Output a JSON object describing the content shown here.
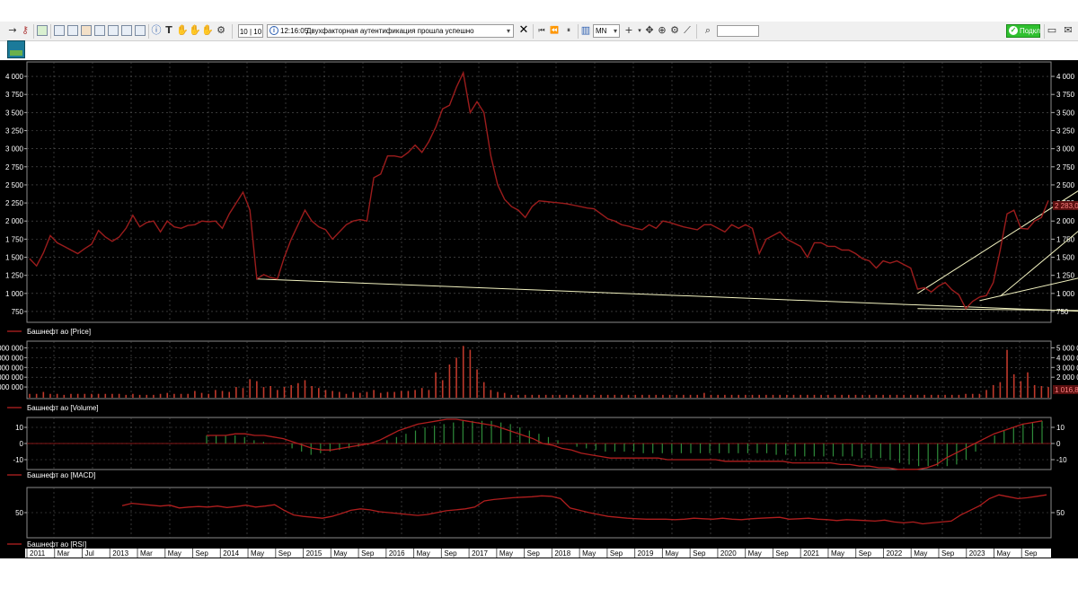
{
  "toolbar": {
    "counter": "10 | 10",
    "message_time": "12:16:05",
    "message_text": "Двухфакторная аутентификация прошла успешно",
    "timeframe": "MN",
    "connect_label": "Подкл"
  },
  "chart_data": [
    {
      "type": "line",
      "legend": "Башнефт ао [Price]",
      "yticks": [
        "4 000",
        "3 750",
        "3 500",
        "3 250",
        "3 000",
        "2 750",
        "2 500",
        "2 250",
        "2 000",
        "1 750",
        "1 500",
        "1 250",
        "1 000",
        "750"
      ],
      "yticks_right": [
        "4 000",
        "3 750",
        "3 500",
        "3 250",
        "3 000",
        "2 750",
        "2 500",
        "2 250",
        "2 000",
        "1 750",
        "1 500",
        "1 250",
        "1 000",
        "750"
      ],
      "ylim": [
        700,
        4100
      ],
      "last_price_label": "2 283,0",
      "series": [
        {
          "values": [
            1480,
            1380,
            1560,
            1800,
            1700,
            1650,
            1600,
            1550,
            1620,
            1680,
            1870,
            1780,
            1720,
            1780,
            1900,
            2080,
            1920,
            1980,
            2000,
            1850,
            2000,
            1920,
            1900,
            1940,
            1950,
            2000,
            1990,
            2000,
            1900,
            2100,
            2250,
            2400,
            2150,
            1200,
            1260,
            1220,
            1200,
            1500,
            1750,
            1950,
            2150,
            2000,
            1920,
            1880,
            1750,
            1850,
            1950,
            2000,
            2020,
            2000,
            2600,
            2650,
            2900,
            2900,
            2880,
            2950,
            3050,
            2950,
            3100,
            3300,
            3550,
            3600,
            3850,
            4050,
            3500,
            3650,
            3500,
            2900,
            2500,
            2300,
            2200,
            2150,
            2050,
            2200,
            2280,
            2270,
            2260,
            2250,
            2240,
            2220,
            2200,
            2180,
            2170,
            2100,
            2030,
            2000,
            1950,
            1930,
            1900,
            1880,
            1950,
            1900,
            2000,
            1980,
            1950,
            1920,
            1900,
            1880,
            1950,
            1950,
            1900,
            1850,
            1950,
            1900,
            1950,
            1900,
            1550,
            1750,
            1800,
            1850,
            1750,
            1700,
            1650,
            1500,
            1700,
            1700,
            1650,
            1650,
            1600,
            1600,
            1550,
            1480,
            1450,
            1350,
            1450,
            1420,
            1450,
            1400,
            1350,
            1060,
            1080,
            1020,
            1100,
            1150,
            1050,
            980,
            790,
            890,
            950,
            970,
            1150,
            1600,
            2100,
            2150,
            1900,
            1890,
            2000,
            2050,
            2283
          ]
        }
      ],
      "trendlines": [
        {
          "from": [
            33,
            1200
          ],
          "to": [
            156,
            740
          ]
        },
        {
          "from": [
            129,
            1000
          ],
          "to": [
            156,
            2640
          ]
        },
        {
          "from": [
            141,
            960
          ],
          "to": [
            156,
            2150
          ]
        },
        {
          "from": [
            138,
            900
          ],
          "to": [
            156,
            1290
          ]
        },
        {
          "from": [
            129,
            790
          ],
          "to": [
            156,
            760
          ]
        }
      ]
    },
    {
      "type": "bar",
      "legend": "Башнефт ао [Volume]",
      "yticks": [
        "000 000",
        "000 000",
        "000 000",
        "000 000",
        "000 000"
      ],
      "yticks_right": [
        "5 000 0",
        "4 000 0",
        "3 000 0",
        "2 000 0"
      ],
      "ylim": [
        0,
        5500000
      ],
      "last_value_label": "1 016,8",
      "series": [
        {
          "values": [
            300000,
            300000,
            500000,
            300000,
            300000,
            200000,
            300000,
            300000,
            300000,
            300000,
            300000,
            300000,
            300000,
            300000,
            200000,
            300000,
            200000,
            200000,
            200000,
            300000,
            400000,
            300000,
            300000,
            300000,
            600000,
            400000,
            300000,
            700000,
            600000,
            500000,
            1000000,
            900000,
            1800000,
            1600000,
            1000000,
            1100000,
            700000,
            1000000,
            1200000,
            1400000,
            1700000,
            1100000,
            900000,
            700000,
            600000,
            500000,
            300000,
            500000,
            400000,
            500000,
            700000,
            400000,
            500000,
            500000,
            600000,
            600000,
            700000,
            900000,
            700000,
            2500000,
            1700000,
            3300000,
            4000000,
            5200000,
            4800000,
            2800000,
            1500000,
            700000,
            500000,
            400000,
            200000,
            200000,
            200000,
            200000,
            200000,
            200000,
            200000,
            200000,
            200000,
            200000,
            200000,
            200000,
            200000,
            200000,
            200000,
            200000,
            200000,
            200000,
            200000,
            200000,
            200000,
            200000,
            200000,
            200000,
            200000,
            200000,
            200000,
            200000,
            400000,
            200000,
            200000,
            200000,
            200000,
            200000,
            200000,
            200000,
            200000,
            200000,
            200000,
            200000,
            200000,
            200000,
            200000,
            200000,
            200000,
            200000,
            200000,
            200000,
            200000,
            200000,
            200000,
            200000,
            200000,
            200000,
            200000,
            200000,
            200000,
            200000,
            200000,
            200000,
            200000,
            200000,
            200000,
            200000,
            200000,
            200000,
            300000,
            300000,
            300000,
            700000,
            1200000,
            1500000,
            4800000,
            2300000,
            1600000,
            2500000,
            1200000,
            1100000,
            1000000
          ]
        }
      ]
    },
    {
      "type": "bar",
      "legend": "Башнефт ао [MACD]",
      "yticks": [
        "10",
        "0",
        "-10"
      ],
      "yticks_right": [
        "10",
        "0",
        "-10"
      ],
      "ylim": [
        -15,
        15
      ],
      "series": [
        {
          "values": [
            5,
            5,
            5,
            5,
            4,
            2,
            1,
            0,
            0,
            -3,
            -5,
            -7,
            -6,
            -5,
            -4,
            -3,
            -2,
            -1,
            0,
            2,
            4,
            6,
            8,
            10,
            11,
            12,
            13,
            14,
            14,
            14,
            14,
            13,
            12,
            10,
            8,
            6,
            4,
            2,
            0,
            -2,
            -3,
            -4,
            -5,
            -5,
            -5,
            -5,
            -6,
            -6,
            -6,
            -6,
            -6,
            -6,
            -6,
            -6,
            -6,
            -6,
            -6,
            -6,
            -6,
            -6,
            -7,
            -7,
            -8,
            -8,
            -8,
            -8,
            -8,
            -8,
            -8,
            -9,
            -9,
            -9,
            -10,
            -12,
            -13,
            -14,
            -14,
            -14,
            -14,
            -13,
            -10,
            -5,
            0,
            5,
            8,
            10,
            12,
            13,
            14
          ]
        },
        {
          "values": [
            5,
            5,
            5,
            6,
            6,
            5,
            5,
            4,
            3,
            1,
            -1,
            -3,
            -4,
            -4,
            -3,
            -2,
            -1,
            0,
            2,
            5,
            8,
            10,
            12,
            13,
            14,
            15,
            15,
            14,
            13,
            12,
            11,
            9,
            7,
            5,
            3,
            0,
            -1,
            -3,
            -4,
            -6,
            -7,
            -8,
            -9,
            -9,
            -9,
            -9,
            -9,
            -9,
            -10,
            -10,
            -10,
            -10,
            -10,
            -10,
            -11,
            -11,
            -11,
            -11,
            -11,
            -11,
            -11,
            -12,
            -12,
            -12,
            -12,
            -12,
            -13,
            -13,
            -14,
            -14,
            -15,
            -15,
            -16,
            -16,
            -16,
            -15,
            -13,
            -9,
            -6,
            -3,
            0,
            3,
            6,
            8,
            10,
            12,
            13,
            14
          ]
        }
      ]
    },
    {
      "type": "line",
      "legend": "Башнефт ао [RSI]",
      "yticks": [
        "50"
      ],
      "yticks_right": [
        "50"
      ],
      "ylim": [
        0,
        100
      ],
      "series": [
        {
          "values": [
            65,
            70,
            68,
            66,
            64,
            66,
            60,
            62,
            63,
            62,
            64,
            61,
            63,
            66,
            62,
            64,
            67,
            55,
            45,
            42,
            40,
            38,
            42,
            48,
            55,
            58,
            56,
            52,
            50,
            48,
            46,
            44,
            46,
            50,
            54,
            56,
            58,
            62,
            75,
            78,
            80,
            82,
            83,
            84,
            86,
            85,
            80,
            60,
            55,
            50,
            46,
            42,
            40,
            38,
            37,
            36,
            36,
            36,
            35,
            36,
            38,
            37,
            36,
            38,
            36,
            35,
            37,
            38,
            39,
            40,
            36,
            37,
            38,
            36,
            35,
            33,
            35,
            34,
            33,
            32,
            34,
            30,
            28,
            30,
            26,
            28,
            30,
            32,
            45,
            55,
            65,
            80,
            88,
            84,
            80,
            82,
            85,
            88
          ]
        }
      ]
    }
  ],
  "xaxis_labels": [
    "2011",
    "Mar",
    "Jul",
    "2013",
    "Mar",
    "May",
    "Sep",
    "2014",
    "May",
    "Sep",
    "2015",
    "May",
    "Sep",
    "2016",
    "May",
    "Sep",
    "2017",
    "May",
    "Sep",
    "2018",
    "May",
    "Sep",
    "2019",
    "May",
    "Sep",
    "2020",
    "May",
    "Sep",
    "2021",
    "May",
    "Sep",
    "2022",
    "May",
    "Sep",
    "2023",
    "May",
    "Sep"
  ]
}
